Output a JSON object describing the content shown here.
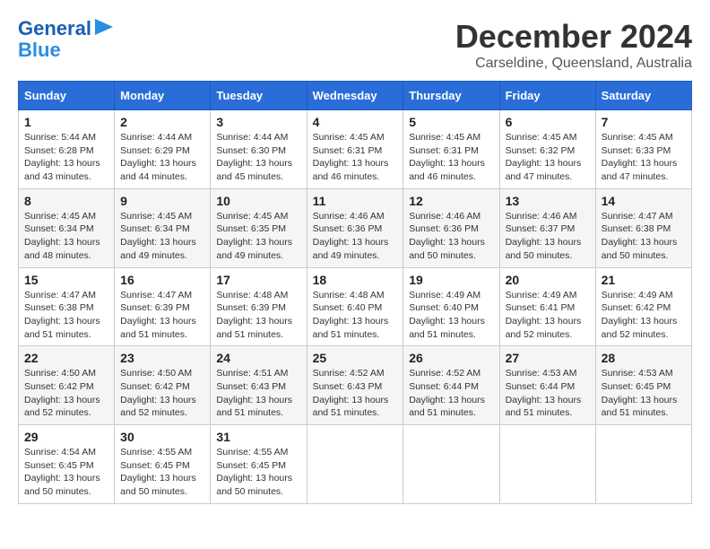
{
  "logo": {
    "line1": "General",
    "line2": "Blue"
  },
  "title": "December 2024",
  "subtitle": "Carseldine, Queensland, Australia",
  "days_header": [
    "Sunday",
    "Monday",
    "Tuesday",
    "Wednesday",
    "Thursday",
    "Friday",
    "Saturday"
  ],
  "weeks": [
    [
      {
        "day": "1",
        "sunrise": "5:44 AM",
        "sunset": "6:28 PM",
        "daylight": "13 hours and 43 minutes."
      },
      {
        "day": "2",
        "sunrise": "4:44 AM",
        "sunset": "6:29 PM",
        "daylight": "13 hours and 44 minutes."
      },
      {
        "day": "3",
        "sunrise": "4:44 AM",
        "sunset": "6:30 PM",
        "daylight": "13 hours and 45 minutes."
      },
      {
        "day": "4",
        "sunrise": "4:45 AM",
        "sunset": "6:31 PM",
        "daylight": "13 hours and 46 minutes."
      },
      {
        "day": "5",
        "sunrise": "4:45 AM",
        "sunset": "6:31 PM",
        "daylight": "13 hours and 46 minutes."
      },
      {
        "day": "6",
        "sunrise": "4:45 AM",
        "sunset": "6:32 PM",
        "daylight": "13 hours and 47 minutes."
      },
      {
        "day": "7",
        "sunrise": "4:45 AM",
        "sunset": "6:33 PM",
        "daylight": "13 hours and 47 minutes."
      }
    ],
    [
      {
        "day": "8",
        "sunrise": "4:45 AM",
        "sunset": "6:34 PM",
        "daylight": "13 hours and 48 minutes."
      },
      {
        "day": "9",
        "sunrise": "4:45 AM",
        "sunset": "6:34 PM",
        "daylight": "13 hours and 49 minutes."
      },
      {
        "day": "10",
        "sunrise": "4:45 AM",
        "sunset": "6:35 PM",
        "daylight": "13 hours and 49 minutes."
      },
      {
        "day": "11",
        "sunrise": "4:46 AM",
        "sunset": "6:36 PM",
        "daylight": "13 hours and 49 minutes."
      },
      {
        "day": "12",
        "sunrise": "4:46 AM",
        "sunset": "6:36 PM",
        "daylight": "13 hours and 50 minutes."
      },
      {
        "day": "13",
        "sunrise": "4:46 AM",
        "sunset": "6:37 PM",
        "daylight": "13 hours and 50 minutes."
      },
      {
        "day": "14",
        "sunrise": "4:47 AM",
        "sunset": "6:38 PM",
        "daylight": "13 hours and 50 minutes."
      }
    ],
    [
      {
        "day": "15",
        "sunrise": "4:47 AM",
        "sunset": "6:38 PM",
        "daylight": "13 hours and 51 minutes."
      },
      {
        "day": "16",
        "sunrise": "4:47 AM",
        "sunset": "6:39 PM",
        "daylight": "13 hours and 51 minutes."
      },
      {
        "day": "17",
        "sunrise": "4:48 AM",
        "sunset": "6:39 PM",
        "daylight": "13 hours and 51 minutes."
      },
      {
        "day": "18",
        "sunrise": "4:48 AM",
        "sunset": "6:40 PM",
        "daylight": "13 hours and 51 minutes."
      },
      {
        "day": "19",
        "sunrise": "4:49 AM",
        "sunset": "6:40 PM",
        "daylight": "13 hours and 51 minutes."
      },
      {
        "day": "20",
        "sunrise": "4:49 AM",
        "sunset": "6:41 PM",
        "daylight": "13 hours and 52 minutes."
      },
      {
        "day": "21",
        "sunrise": "4:49 AM",
        "sunset": "6:42 PM",
        "daylight": "13 hours and 52 minutes."
      }
    ],
    [
      {
        "day": "22",
        "sunrise": "4:50 AM",
        "sunset": "6:42 PM",
        "daylight": "13 hours and 52 minutes."
      },
      {
        "day": "23",
        "sunrise": "4:50 AM",
        "sunset": "6:42 PM",
        "daylight": "13 hours and 52 minutes."
      },
      {
        "day": "24",
        "sunrise": "4:51 AM",
        "sunset": "6:43 PM",
        "daylight": "13 hours and 51 minutes."
      },
      {
        "day": "25",
        "sunrise": "4:52 AM",
        "sunset": "6:43 PM",
        "daylight": "13 hours and 51 minutes."
      },
      {
        "day": "26",
        "sunrise": "4:52 AM",
        "sunset": "6:44 PM",
        "daylight": "13 hours and 51 minutes."
      },
      {
        "day": "27",
        "sunrise": "4:53 AM",
        "sunset": "6:44 PM",
        "daylight": "13 hours and 51 minutes."
      },
      {
        "day": "28",
        "sunrise": "4:53 AM",
        "sunset": "6:45 PM",
        "daylight": "13 hours and 51 minutes."
      }
    ],
    [
      {
        "day": "29",
        "sunrise": "4:54 AM",
        "sunset": "6:45 PM",
        "daylight": "13 hours and 50 minutes."
      },
      {
        "day": "30",
        "sunrise": "4:55 AM",
        "sunset": "6:45 PM",
        "daylight": "13 hours and 50 minutes."
      },
      {
        "day": "31",
        "sunrise": "4:55 AM",
        "sunset": "6:45 PM",
        "daylight": "13 hours and 50 minutes."
      },
      null,
      null,
      null,
      null
    ]
  ]
}
